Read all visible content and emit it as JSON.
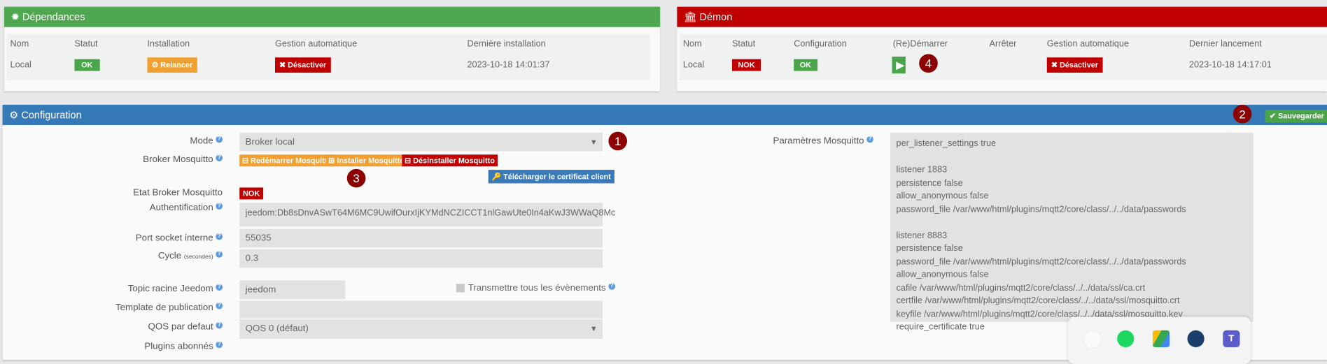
{
  "dependances": {
    "title": "Dépendances",
    "headers": [
      "Nom",
      "Statut",
      "Installation",
      "Gestion automatique",
      "Dernière installation"
    ],
    "row": {
      "nom": "Local",
      "statut": "OK",
      "installation": "Relancer",
      "gestion": "Désactiver",
      "derniere": "2023-10-18 14:01:37"
    }
  },
  "demon": {
    "title": "Démon",
    "headers": [
      "Nom",
      "Statut",
      "Configuration",
      "(Re)Démarrer",
      "Arrêter",
      "Gestion automatique",
      "Dernier lancement"
    ],
    "row": {
      "nom": "Local",
      "statut": "NOK",
      "configuration": "OK",
      "gestion": "Désactiver",
      "dernier": "2023-10-18 14:17:01"
    }
  },
  "config": {
    "title": "Configuration",
    "save": "Sauvegarder",
    "labels": {
      "mode": "Mode",
      "broker": "Broker Mosquitto",
      "etat": "Etat Broker Mosquitto",
      "auth": "Authentification",
      "port": "Port socket interne",
      "cycle": "Cycle",
      "cycle_unit": "(secondes)",
      "topic": "Topic racine Jeedom",
      "template": "Template de publication",
      "qos": "QOS par defaut",
      "plugins": "Plugins abonnés",
      "params": "Paramètres Mosquitto",
      "transmettre": "Transmettre tous les évènements"
    },
    "values": {
      "mode": "Broker local",
      "etat": "NOK",
      "auth": "jeedom:Db8sDnvASwT64M6MC9UwifOurxIjKYMdNCZICCT1nlGawUte0In4aKwJ3WWaQ8Mc",
      "port": "55035",
      "cycle": "0.3",
      "topic": "jeedom",
      "template": "",
      "qos": "QOS 0 (défaut)",
      "params": "per_listener_settings true\n\nlistener 1883\npersistence false\nallow_anonymous false\npassword_file /var/www/html/plugins/mqtt2/core/class/../../data/passwords\n\nlistener 8883\npersistence false\npassword_file /var/www/html/plugins/mqtt2/core/class/../../data/passwords\nallow_anonymous false\ncafile /var/www/html/plugins/mqtt2/core/class/../../data/ssl/ca.crt\ncertfile /var/www/html/plugins/mqtt2/core/class/../../data/ssl/mosquitto.crt\nkeyfile /var/www/html/plugins/mqtt2/core/class/../../data/ssl/mosquitto.key\nrequire_certificate true"
    },
    "buttons": {
      "restart": "Redémarrer Mosquitto",
      "install": "Installer Mosquitto",
      "uninstall": "Désinstaller Mosquitto",
      "cert": "Télécharger le certificat client"
    }
  },
  "markers": [
    "1",
    "2",
    "3",
    "4"
  ],
  "tray": [
    "app-icon",
    "spotify-icon",
    "google-drive-icon",
    "steam-icon",
    "teams-icon"
  ],
  "colors": {
    "green": "#4fa84f",
    "red": "#c00000",
    "blue": "#357ab7"
  }
}
